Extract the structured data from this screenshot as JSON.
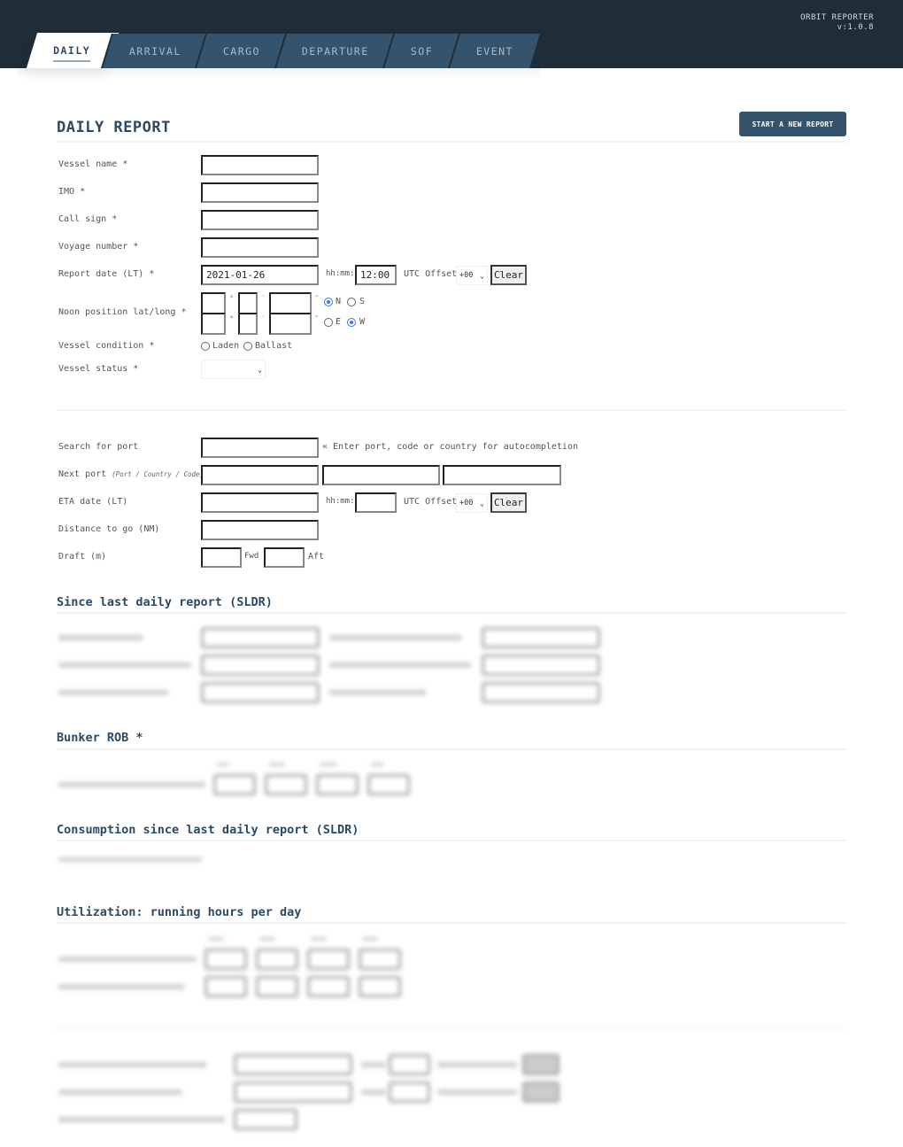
{
  "app": {
    "name": "ORBIT REPORTER",
    "version": "v:1.0.8"
  },
  "tabs": [
    {
      "label": "DAILY",
      "active": true
    },
    {
      "label": "ARRIVAL",
      "active": false
    },
    {
      "label": "CARGO",
      "active": false
    },
    {
      "label": "DEPARTURE",
      "active": false
    },
    {
      "label": "SOF",
      "active": false
    },
    {
      "label": "EVENT",
      "active": false
    }
  ],
  "page": {
    "title": "DAILY REPORT",
    "new_report_button": "START A NEW REPORT"
  },
  "vessel": {
    "vessel_name": {
      "label": "Vessel name *",
      "value": ""
    },
    "imo": {
      "label": "IMO *",
      "value": ""
    },
    "call_sign": {
      "label": "Call sign *",
      "value": ""
    },
    "voyage_number": {
      "label": "Voyage number *",
      "value": ""
    },
    "report_date": {
      "label": "Report date (LT) *",
      "date": "2021-01-26",
      "time_label": "hh:mm:",
      "time": "12:00",
      "utc_label": "UTC Offset:",
      "utc_value": "+00",
      "clear_label": "Clear"
    },
    "noon_position": {
      "label": "Noon position lat/long *",
      "deg_mark": "°",
      "min_mark": "′",
      "sec_mark": "″",
      "lat": {
        "deg": "",
        "min": "",
        "sec": "",
        "options": [
          "N",
          "S"
        ],
        "selected": "N"
      },
      "long": {
        "deg": "",
        "min": "",
        "sec": "",
        "options": [
          "E",
          "W"
        ],
        "selected": "W"
      }
    },
    "vessel_condition": {
      "label": "Vessel condition *",
      "options": [
        "Laden",
        "Ballast"
      ],
      "selected": null
    },
    "vessel_status": {
      "label": "Vessel status *",
      "value": ""
    }
  },
  "port": {
    "search": {
      "label": "Search for port",
      "value": "",
      "hint": "« Enter port, code or country for autocompletion"
    },
    "next_port": {
      "label": "Next port",
      "sublabel": "(Port / Country / Code)",
      "port": "",
      "country": "",
      "code": ""
    },
    "eta": {
      "label": "ETA date (LT)",
      "date": "",
      "time_label": "hh:mm:",
      "time": "",
      "utc_label": "UTC Offset:",
      "utc_value": "+00",
      "clear_label": "Clear"
    },
    "distance_to_go": {
      "label": "Distance to go (NM)",
      "value": ""
    },
    "draft": {
      "label": "Draft (m)",
      "fwd": "",
      "fwd_label": "Fwd",
      "aft": "",
      "aft_label": "Aft"
    }
  },
  "sections": {
    "sldr": "Since last daily report (SLDR)",
    "bunker": "Bunker ROB *",
    "consumption": "Consumption since last daily report (SLDR)",
    "utilization": "Utilization: running hours per day"
  }
}
